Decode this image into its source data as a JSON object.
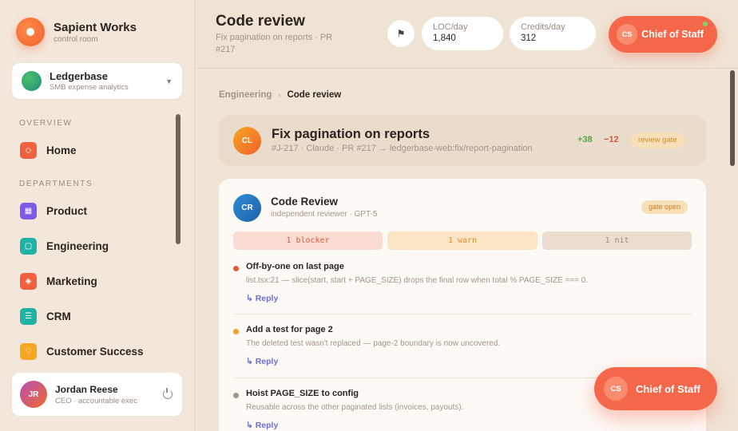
{
  "brand": {
    "name": "Sapient Works",
    "subtitle": "control room"
  },
  "workspace": {
    "name": "Ledgerbase",
    "subtitle": "SMB expense analytics"
  },
  "sidebar": {
    "overview_label": "OVERVIEW",
    "departments_label": "DEPARTMENTS",
    "items": [
      {
        "label": "Home",
        "icon": "home-icon",
        "color": "#f0613f"
      },
      {
        "label": "Product",
        "icon": "grid-icon",
        "color": "#7b5ce6"
      },
      {
        "label": "Engineering",
        "icon": "code-icon",
        "color": "#1fb3a4"
      },
      {
        "label": "Marketing",
        "icon": "megaphone-icon",
        "color": "#f0613f"
      },
      {
        "label": "CRM",
        "icon": "contacts-icon",
        "color": "#1fb3a4"
      },
      {
        "label": "Customer Success",
        "icon": "heart-icon",
        "color": "#f5a623"
      }
    ]
  },
  "user": {
    "initials": "JR",
    "name": "Jordan Reese",
    "role": "CEO · accountable exec"
  },
  "header": {
    "title": "Code review",
    "subtitle": "Fix pagination on reports · PR #217",
    "stats": [
      {
        "label": "LOC/day",
        "value": "1,840"
      },
      {
        "label": "Credits/day",
        "value": "312"
      }
    ],
    "chief": {
      "initials": "CS",
      "label": "Chief of Staff"
    }
  },
  "breadcrumb": {
    "parent": "Engineering",
    "current": "Code review"
  },
  "ticket": {
    "initials": "CL",
    "title": "Fix pagination on reports",
    "meta": "#J-217 · Claude · PR #217 → ledgerbase-web:fix/report-pagination",
    "additions": "+38",
    "deletions": "−12",
    "badge": "review gate"
  },
  "review": {
    "initials": "CR",
    "title": "Code Review",
    "subtitle": "independent reviewer · GPT-5",
    "badge": "gate open",
    "tally": {
      "blocker": "1 blocker",
      "warn": "1 warn",
      "nit": "1 nit"
    },
    "findings": [
      {
        "severity": "blocker",
        "color": "#e15a3c",
        "title": "Off-by-one on last page",
        "desc": "list.tsx:21 — slice(start, start + PAGE_SIZE) drops the final row when total % PAGE_SIZE === 0.",
        "reply": "↳ Reply"
      },
      {
        "severity": "warn",
        "color": "#f0a22e",
        "title": "Add a test for page 2",
        "desc": "The deleted test wasn't replaced — page-2 boundary is now uncovered.",
        "reply": "↳ Reply"
      },
      {
        "severity": "nit",
        "color": "#a39585",
        "title": "Hoist PAGE_SIZE to config",
        "desc": "Reusable across the other paginated lists (invoices, payouts).",
        "reply": "↳ Reply"
      }
    ]
  },
  "floating_chief": {
    "initials": "CS",
    "label": "Chief of Staff"
  }
}
